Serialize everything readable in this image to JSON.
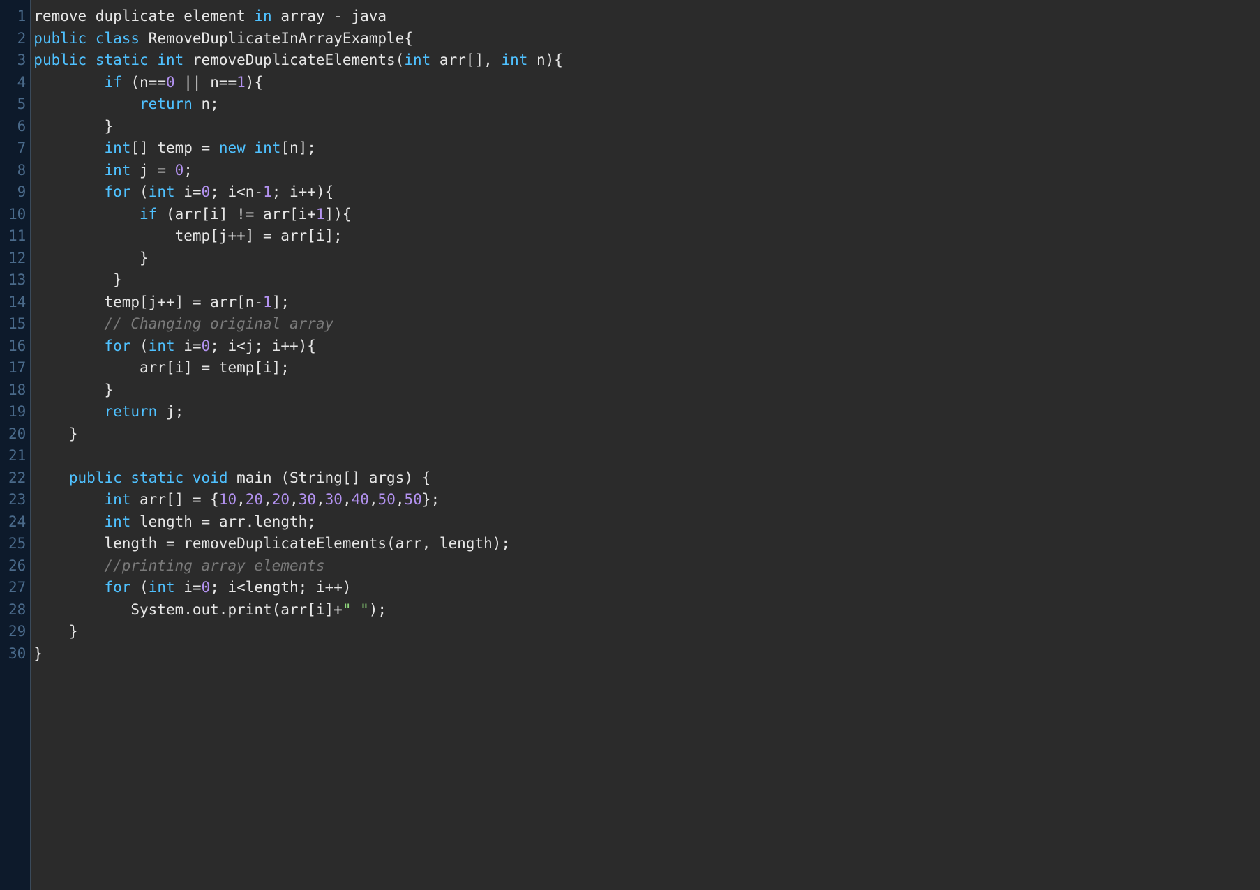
{
  "lines": [
    {
      "num": "1",
      "tokens": [
        {
          "cls": "tok-default",
          "t": "remove duplicate element "
        },
        {
          "cls": "tok-keyword",
          "t": "in"
        },
        {
          "cls": "tok-default",
          "t": " array - java"
        }
      ]
    },
    {
      "num": "2",
      "tokens": [
        {
          "cls": "tok-keyword",
          "t": "public"
        },
        {
          "cls": "tok-default",
          "t": " "
        },
        {
          "cls": "tok-keyword",
          "t": "class"
        },
        {
          "cls": "tok-default",
          "t": " RemoveDuplicateInArrayExample{  "
        }
      ]
    },
    {
      "num": "3",
      "tokens": [
        {
          "cls": "tok-keyword",
          "t": "public"
        },
        {
          "cls": "tok-default",
          "t": " "
        },
        {
          "cls": "tok-keyword",
          "t": "static"
        },
        {
          "cls": "tok-default",
          "t": " "
        },
        {
          "cls": "tok-keyword",
          "t": "int"
        },
        {
          "cls": "tok-default",
          "t": " removeDuplicateElements("
        },
        {
          "cls": "tok-keyword",
          "t": "int"
        },
        {
          "cls": "tok-default",
          "t": " arr[], "
        },
        {
          "cls": "tok-keyword",
          "t": "int"
        },
        {
          "cls": "tok-default",
          "t": " n){  "
        }
      ]
    },
    {
      "num": "4",
      "tokens": [
        {
          "cls": "tok-default",
          "t": "        "
        },
        {
          "cls": "tok-keyword",
          "t": "if"
        },
        {
          "cls": "tok-default",
          "t": " (n=="
        },
        {
          "cls": "tok-number",
          "t": "0"
        },
        {
          "cls": "tok-default",
          "t": " || n=="
        },
        {
          "cls": "tok-number",
          "t": "1"
        },
        {
          "cls": "tok-default",
          "t": "){  "
        }
      ]
    },
    {
      "num": "5",
      "tokens": [
        {
          "cls": "tok-default",
          "t": "            "
        },
        {
          "cls": "tok-keyword",
          "t": "return"
        },
        {
          "cls": "tok-default",
          "t": " n;  "
        }
      ]
    },
    {
      "num": "6",
      "tokens": [
        {
          "cls": "tok-default",
          "t": "        }  "
        }
      ]
    },
    {
      "num": "7",
      "tokens": [
        {
          "cls": "tok-default",
          "t": "        "
        },
        {
          "cls": "tok-keyword",
          "t": "int"
        },
        {
          "cls": "tok-default",
          "t": "[] temp = "
        },
        {
          "cls": "tok-keyword",
          "t": "new"
        },
        {
          "cls": "tok-default",
          "t": " "
        },
        {
          "cls": "tok-keyword",
          "t": "int"
        },
        {
          "cls": "tok-default",
          "t": "[n];  "
        }
      ]
    },
    {
      "num": "8",
      "tokens": [
        {
          "cls": "tok-default",
          "t": "        "
        },
        {
          "cls": "tok-keyword",
          "t": "int"
        },
        {
          "cls": "tok-default",
          "t": " j = "
        },
        {
          "cls": "tok-number",
          "t": "0"
        },
        {
          "cls": "tok-default",
          "t": ";  "
        }
      ]
    },
    {
      "num": "9",
      "tokens": [
        {
          "cls": "tok-default",
          "t": "        "
        },
        {
          "cls": "tok-keyword",
          "t": "for"
        },
        {
          "cls": "tok-default",
          "t": " ("
        },
        {
          "cls": "tok-keyword",
          "t": "int"
        },
        {
          "cls": "tok-default",
          "t": " i="
        },
        {
          "cls": "tok-number",
          "t": "0"
        },
        {
          "cls": "tok-default",
          "t": "; i<n-"
        },
        {
          "cls": "tok-number",
          "t": "1"
        },
        {
          "cls": "tok-default",
          "t": "; i++){  "
        }
      ]
    },
    {
      "num": "10",
      "tokens": [
        {
          "cls": "tok-default",
          "t": "            "
        },
        {
          "cls": "tok-keyword",
          "t": "if"
        },
        {
          "cls": "tok-default",
          "t": " (arr[i] != arr[i+"
        },
        {
          "cls": "tok-number",
          "t": "1"
        },
        {
          "cls": "tok-default",
          "t": "]){  "
        }
      ]
    },
    {
      "num": "11",
      "tokens": [
        {
          "cls": "tok-default",
          "t": "                temp[j++] = arr[i];  "
        }
      ]
    },
    {
      "num": "12",
      "tokens": [
        {
          "cls": "tok-default",
          "t": "            }  "
        }
      ]
    },
    {
      "num": "13",
      "tokens": [
        {
          "cls": "tok-default",
          "t": "         }  "
        }
      ]
    },
    {
      "num": "14",
      "tokens": [
        {
          "cls": "tok-default",
          "t": "        temp[j++] = arr[n-"
        },
        {
          "cls": "tok-number",
          "t": "1"
        },
        {
          "cls": "tok-default",
          "t": "];     "
        }
      ]
    },
    {
      "num": "15",
      "tokens": [
        {
          "cls": "tok-default",
          "t": "        "
        },
        {
          "cls": "tok-comment",
          "t": "// Changing original array  "
        }
      ]
    },
    {
      "num": "16",
      "tokens": [
        {
          "cls": "tok-default",
          "t": "        "
        },
        {
          "cls": "tok-keyword",
          "t": "for"
        },
        {
          "cls": "tok-default",
          "t": " ("
        },
        {
          "cls": "tok-keyword",
          "t": "int"
        },
        {
          "cls": "tok-default",
          "t": " i="
        },
        {
          "cls": "tok-number",
          "t": "0"
        },
        {
          "cls": "tok-default",
          "t": "; i<j; i++){  "
        }
      ]
    },
    {
      "num": "17",
      "tokens": [
        {
          "cls": "tok-default",
          "t": "            arr[i] = temp[i];  "
        }
      ]
    },
    {
      "num": "18",
      "tokens": [
        {
          "cls": "tok-default",
          "t": "        }  "
        }
      ]
    },
    {
      "num": "19",
      "tokens": [
        {
          "cls": "tok-default",
          "t": "        "
        },
        {
          "cls": "tok-keyword",
          "t": "return"
        },
        {
          "cls": "tok-default",
          "t": " j;  "
        }
      ]
    },
    {
      "num": "20",
      "tokens": [
        {
          "cls": "tok-default",
          "t": "    }  "
        }
      ]
    },
    {
      "num": "21",
      "tokens": [
        {
          "cls": "tok-default",
          "t": "       "
        }
      ]
    },
    {
      "num": "22",
      "tokens": [
        {
          "cls": "tok-default",
          "t": "    "
        },
        {
          "cls": "tok-keyword",
          "t": "public"
        },
        {
          "cls": "tok-default",
          "t": " "
        },
        {
          "cls": "tok-keyword",
          "t": "static"
        },
        {
          "cls": "tok-default",
          "t": " "
        },
        {
          "cls": "tok-keyword",
          "t": "void"
        },
        {
          "cls": "tok-default",
          "t": " main (String[] args) {  "
        }
      ]
    },
    {
      "num": "23",
      "tokens": [
        {
          "cls": "tok-default",
          "t": "        "
        },
        {
          "cls": "tok-keyword",
          "t": "int"
        },
        {
          "cls": "tok-default",
          "t": " arr[] = {"
        },
        {
          "cls": "tok-number",
          "t": "10"
        },
        {
          "cls": "tok-default",
          "t": ","
        },
        {
          "cls": "tok-number",
          "t": "20"
        },
        {
          "cls": "tok-default",
          "t": ","
        },
        {
          "cls": "tok-number",
          "t": "20"
        },
        {
          "cls": "tok-default",
          "t": ","
        },
        {
          "cls": "tok-number",
          "t": "30"
        },
        {
          "cls": "tok-default",
          "t": ","
        },
        {
          "cls": "tok-number",
          "t": "30"
        },
        {
          "cls": "tok-default",
          "t": ","
        },
        {
          "cls": "tok-number",
          "t": "40"
        },
        {
          "cls": "tok-default",
          "t": ","
        },
        {
          "cls": "tok-number",
          "t": "50"
        },
        {
          "cls": "tok-default",
          "t": ","
        },
        {
          "cls": "tok-number",
          "t": "50"
        },
        {
          "cls": "tok-default",
          "t": "};  "
        }
      ]
    },
    {
      "num": "24",
      "tokens": [
        {
          "cls": "tok-default",
          "t": "        "
        },
        {
          "cls": "tok-keyword",
          "t": "int"
        },
        {
          "cls": "tok-default",
          "t": " length = arr.length;  "
        }
      ]
    },
    {
      "num": "25",
      "tokens": [
        {
          "cls": "tok-default",
          "t": "        length = removeDuplicateElements(arr, length);  "
        }
      ]
    },
    {
      "num": "26",
      "tokens": [
        {
          "cls": "tok-default",
          "t": "        "
        },
        {
          "cls": "tok-comment",
          "t": "//printing array elements  "
        }
      ]
    },
    {
      "num": "27",
      "tokens": [
        {
          "cls": "tok-default",
          "t": "        "
        },
        {
          "cls": "tok-keyword",
          "t": "for"
        },
        {
          "cls": "tok-default",
          "t": " ("
        },
        {
          "cls": "tok-keyword",
          "t": "int"
        },
        {
          "cls": "tok-default",
          "t": " i="
        },
        {
          "cls": "tok-number",
          "t": "0"
        },
        {
          "cls": "tok-default",
          "t": "; i<length; i++)  "
        }
      ]
    },
    {
      "num": "28",
      "tokens": [
        {
          "cls": "tok-default",
          "t": "           System.out.print(arr[i]+"
        },
        {
          "cls": "tok-string",
          "t": "\" \""
        },
        {
          "cls": "tok-default",
          "t": ");  "
        }
      ]
    },
    {
      "num": "29",
      "tokens": [
        {
          "cls": "tok-default",
          "t": "    }  "
        }
      ]
    },
    {
      "num": "30",
      "tokens": [
        {
          "cls": "tok-default",
          "t": "}  "
        }
      ]
    }
  ]
}
